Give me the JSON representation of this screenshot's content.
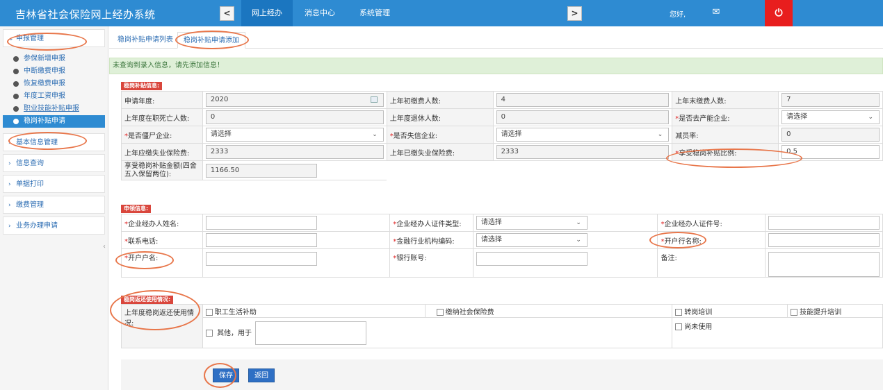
{
  "app": {
    "title": "吉林省社会保险网上经办系统",
    "nav_prev": "<",
    "nav_next": ">",
    "greeting": "您好,",
    "nav_tabs": [
      {
        "label": "网上经办",
        "active": true
      },
      {
        "label": "消息中心",
        "active": false
      },
      {
        "label": "系统管理",
        "active": false
      }
    ]
  },
  "sidebar": {
    "group_declare": "申报管理",
    "items": [
      "参保新增申报",
      "中断缴费申报",
      "恢复缴费申报",
      "年度工资申报",
      "职业技能补贴申报",
      "稳岗补贴申请"
    ],
    "active_item": "稳岗补贴申请",
    "groups": [
      "基本信息管理",
      "信息查询",
      "单据打印",
      "缴费管理",
      "业务办理申请"
    ]
  },
  "tabs": [
    "稳岗补贴申请列表",
    "稳岗补贴申请添加"
  ],
  "alert": "未查询到录入信息，请先添加信息！",
  "subsidy_info": {
    "title": "稳岗补贴信息:",
    "rows": [
      [
        {
          "label": "申请年度:",
          "value": "2020",
          "type": "date"
        },
        {
          "label": "上年初缴费人数:",
          "value": "4",
          "type": "ro"
        },
        {
          "label": "上年末缴费人数:",
          "value": "7",
          "type": "ro"
        }
      ],
      [
        {
          "label": "上年度在职死亡人数:",
          "value": "0",
          "type": "ro"
        },
        {
          "label": "上年度退休人数:",
          "value": "0",
          "type": "ro"
        },
        {
          "label": "是否去产能企业:",
          "value": "请选择",
          "type": "select",
          "required": true
        }
      ],
      [
        {
          "label": "是否僵尸企业:",
          "value": "请选择",
          "type": "select",
          "required": true
        },
        {
          "label": "是否失信企业:",
          "value": "请选择",
          "type": "select",
          "required": true
        },
        {
          "label": "减员率:",
          "value": "0",
          "type": "ro"
        }
      ],
      [
        {
          "label": "上年应缴失业保险费:",
          "value": "2333",
          "type": "ro"
        },
        {
          "label": "上年已缴失业保险费:",
          "value": "2333",
          "type": "ro"
        },
        {
          "label": "享受稳岗补贴比例:",
          "value": "0.5",
          "type": "input",
          "required": true
        }
      ]
    ],
    "amount_label": "享受稳岗补贴金额(四舍五入保留两位):",
    "amount_value": "1166.50"
  },
  "applicant_info": {
    "title": "申领信息:",
    "rows": [
      [
        {
          "label": "企业经办人姓名:",
          "value": "",
          "type": "input",
          "required": true
        },
        {
          "label": "企业经办人证件类型:",
          "value": "请选择",
          "type": "select",
          "required": true
        },
        {
          "label": "企业经办人证件号:",
          "value": "",
          "type": "input",
          "required": true
        }
      ],
      [
        {
          "label": "联系电话:",
          "value": "",
          "type": "input",
          "required": true
        },
        {
          "label": "金融行业机构编码:",
          "value": "请选择",
          "type": "select",
          "required": true
        },
        {
          "label": "开户行名称:",
          "value": "",
          "type": "input",
          "required": true
        }
      ],
      [
        {
          "label": "开户户名:",
          "value": "",
          "type": "input",
          "required": true
        },
        {
          "label": "银行账号:",
          "value": "",
          "type": "input",
          "required": true
        },
        {
          "label": "备注:",
          "value": "",
          "type": "textarea",
          "required": false
        }
      ]
    ]
  },
  "usage_info": {
    "title": "稳岗返还使用情况:",
    "label": "上年度稳岗返还使用情况:",
    "options": [
      "职工生活补助",
      "缴纳社会保险费",
      "转岗培训",
      "技能提升培训",
      "尚未使用"
    ],
    "other_label": "其他，用于"
  },
  "buttons": {
    "save": "保存",
    "back": "返回"
  },
  "colors": {
    "topbar": "#2e8bd2",
    "link": "#2c6db3",
    "alert_bg": "#dff0d8",
    "section_tag": "#d9463c",
    "button": "#2e6fc4",
    "power": "#e81e1e",
    "annotation": "#e8764a"
  }
}
